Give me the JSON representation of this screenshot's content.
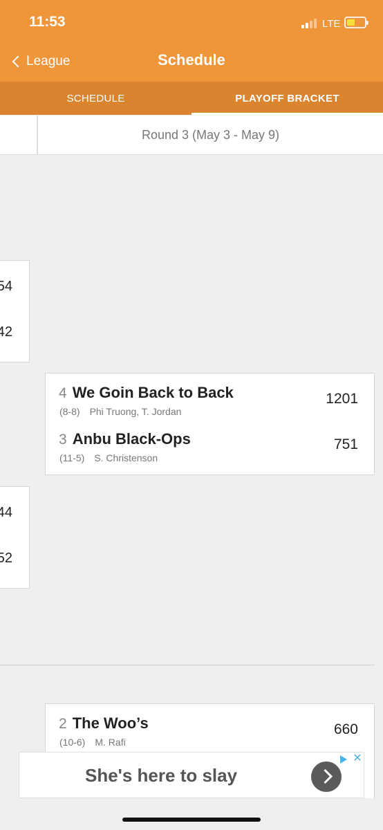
{
  "status_bar": {
    "time": "11:53",
    "network": "LTE"
  },
  "nav": {
    "back_label": "League",
    "title": "Schedule"
  },
  "tabs": [
    {
      "label": "SCHEDULE",
      "active": false
    },
    {
      "label": "PLAYOFF BRACKET",
      "active": true
    }
  ],
  "round_header": "Round 3 (May 3 - May 9)",
  "previous_round_scores": [
    "54",
    "42",
    "44",
    "52"
  ],
  "matchups": [
    {
      "teams": [
        {
          "seed": "4",
          "name": "We Goin Back to Back",
          "record": "(8-8)",
          "owners": "Phi Truong, T. Jordan",
          "score": "1201"
        },
        {
          "seed": "3",
          "name": "Anbu Black-Ops",
          "record": "(11-5)",
          "owners": "S. Christenson",
          "score": "751"
        }
      ]
    },
    {
      "teams": [
        {
          "seed": "2",
          "name": "The Woo’s",
          "record": "(10-6)",
          "owners": "M. Rafi",
          "score": "660"
        }
      ]
    }
  ],
  "ad": {
    "text": "She's here to slay",
    "close": "✕"
  },
  "colors": {
    "header_orange": "#f0963a",
    "tab_bar_orange": "#da8430",
    "battery": "#f6e23a",
    "ad_choice_blue": "#4ab3e8"
  }
}
